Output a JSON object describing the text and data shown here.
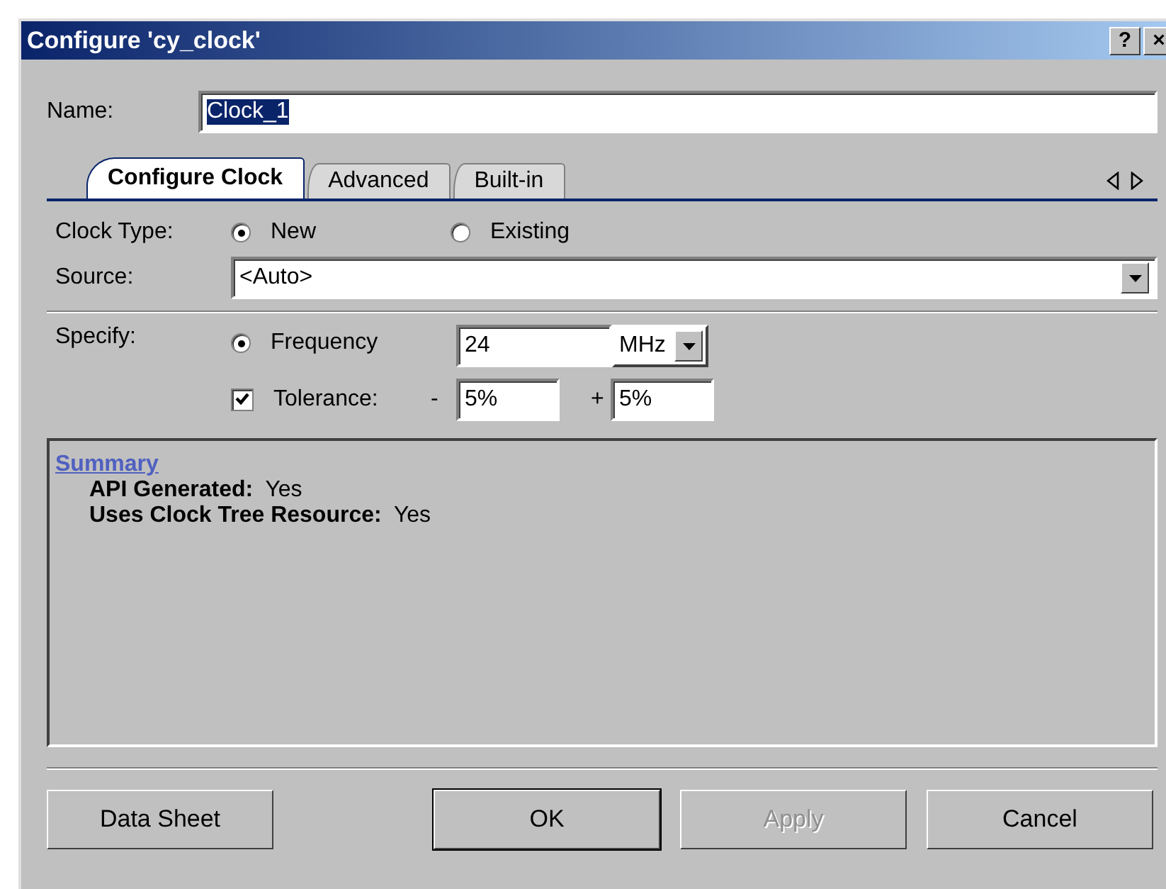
{
  "window": {
    "title": "Configure 'cy_clock'",
    "controls": [
      "?",
      "×"
    ]
  },
  "name": {
    "label": "Name:",
    "value": "Clock_1"
  },
  "tabs": [
    {
      "label": "Configure Clock",
      "selected": true
    },
    {
      "label": "Advanced",
      "selected": false
    },
    {
      "label": "Built-in",
      "selected": false
    }
  ],
  "clock_type": {
    "label": "Clock Type:",
    "options": [
      {
        "label": "New",
        "selected": true
      },
      {
        "label": "Existing",
        "selected": false
      }
    ]
  },
  "source": {
    "label": "Source:",
    "value": "<Auto>"
  },
  "specify": {
    "label": "Specify:",
    "frequency": {
      "label": "Frequency",
      "selected": true,
      "value": "24",
      "unit": "MHz"
    },
    "tolerance": {
      "label": "Tolerance:",
      "checked": true,
      "minus_sign": "-",
      "minus_value": "5%",
      "plus_sign": "+",
      "plus_value": "5%"
    }
  },
  "summary": {
    "title": "Summary",
    "rows": [
      {
        "label": "API Generated:",
        "value": "Yes"
      },
      {
        "label": "Uses Clock Tree Resource:",
        "value": "Yes"
      }
    ]
  },
  "buttons": [
    {
      "label": "Data Sheet",
      "disabled": false,
      "default": false
    },
    {
      "label": "OK",
      "disabled": false,
      "default": true
    },
    {
      "label": "Apply",
      "disabled": true,
      "default": false
    },
    {
      "label": "Cancel",
      "disabled": false,
      "default": false
    }
  ]
}
